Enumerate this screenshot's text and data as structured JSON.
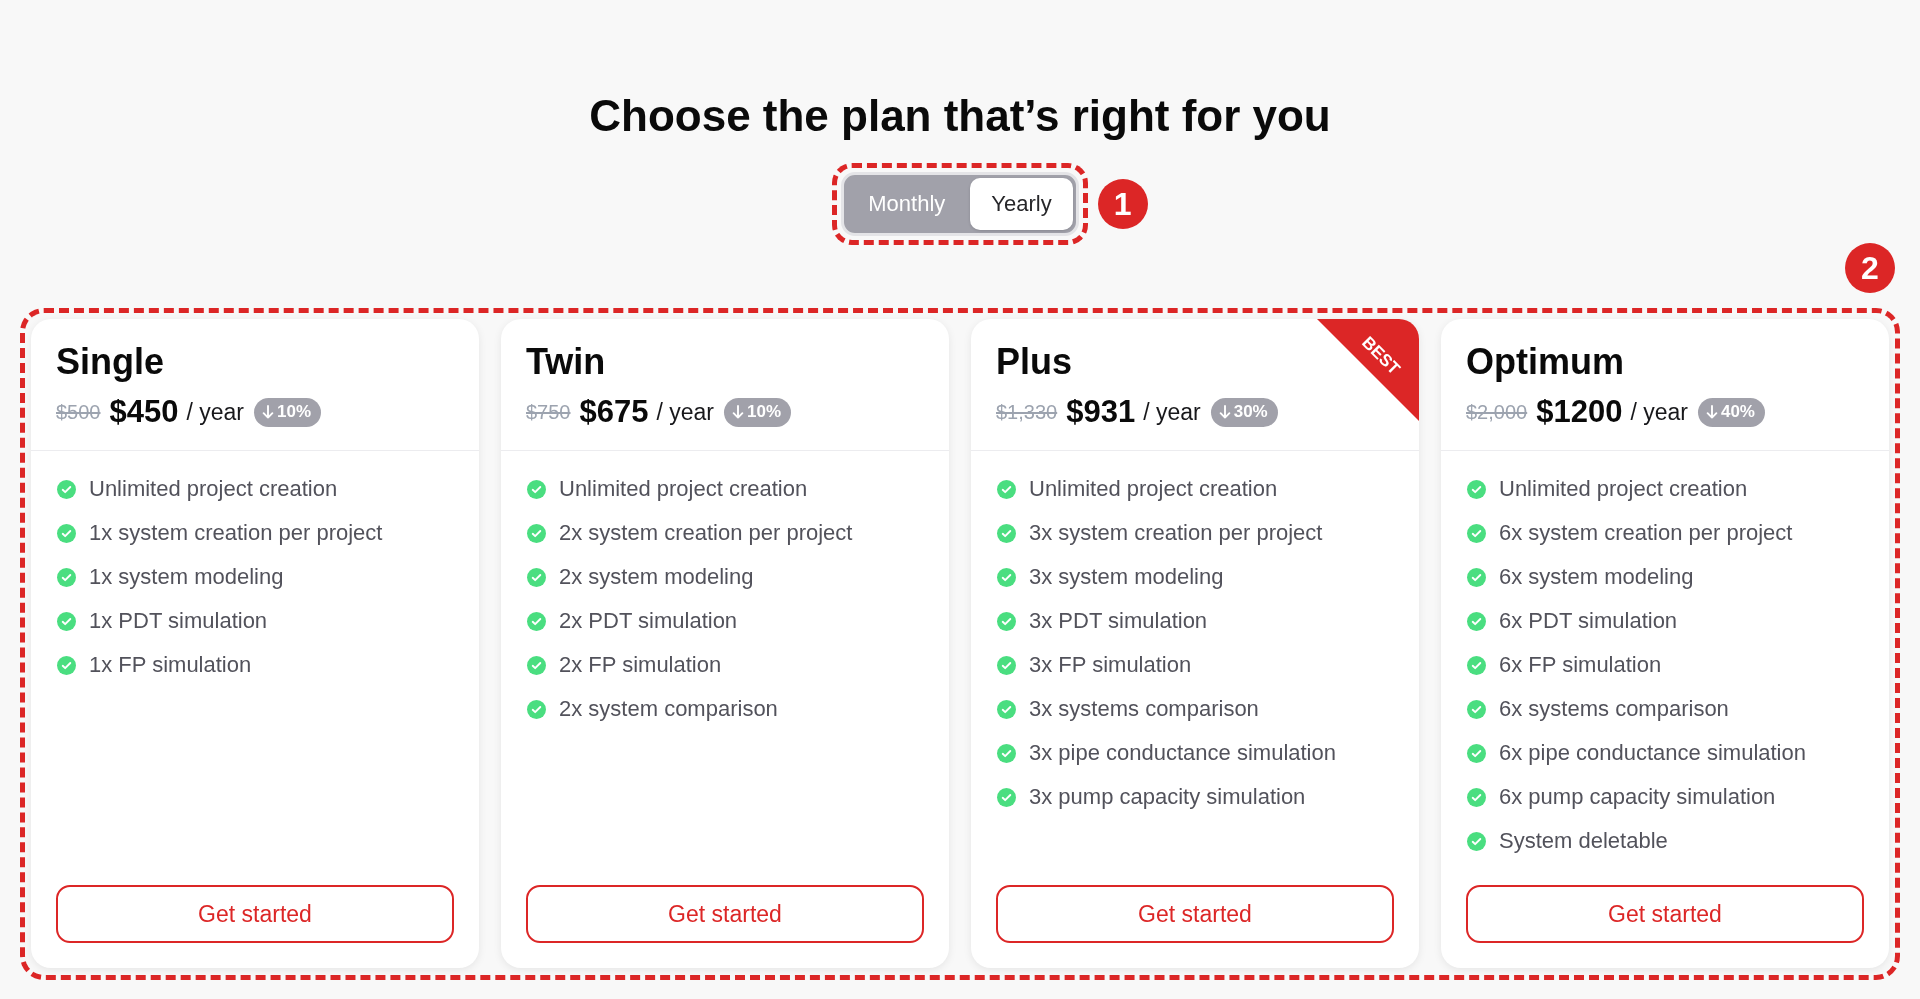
{
  "title": "Choose the plan that’s right for you",
  "billing_toggle": {
    "callout": "1",
    "options": [
      {
        "label": "Monthly",
        "selected": false
      },
      {
        "label": "Yearly",
        "selected": true
      }
    ]
  },
  "plans": {
    "callout": "2",
    "cards": [
      {
        "name": "Single",
        "old_price": "$500",
        "price": "$450",
        "period": "/ year",
        "discount": "10%",
        "features": [
          "Unlimited project creation",
          "1x system creation per project",
          "1x system modeling",
          "1x PDT simulation",
          "1x FP simulation"
        ],
        "button": "Get started"
      },
      {
        "name": "Twin",
        "old_price": "$750",
        "price": "$675",
        "period": "/ year",
        "discount": "10%",
        "features": [
          "Unlimited project creation",
          "2x system creation per project",
          "2x system modeling",
          "2x PDT simulation",
          "2x FP simulation",
          "2x system comparison"
        ],
        "button": "Get started"
      },
      {
        "name": "Plus",
        "old_price": "$1,330",
        "price": "$931",
        "period": "/ year",
        "discount": "30%",
        "ribbon": "BEST",
        "features": [
          "Unlimited project creation",
          "3x system creation per project",
          "3x system modeling",
          "3x PDT simulation",
          "3x FP simulation",
          "3x systems comparison",
          "3x pipe conductance simulation",
          "3x pump capacity simulation"
        ],
        "button": "Get started"
      },
      {
        "name": "Optimum",
        "old_price": "$2,000",
        "price": "$1200",
        "period": "/ year",
        "discount": "40%",
        "features": [
          "Unlimited project creation",
          "6x system creation per project",
          "6x system modeling",
          "6x PDT simulation",
          "6x FP simulation",
          "6x systems comparison",
          "6x pipe conductance simulation",
          "6x pump capacity simulation",
          "System deletable"
        ],
        "button": "Get started"
      }
    ]
  }
}
